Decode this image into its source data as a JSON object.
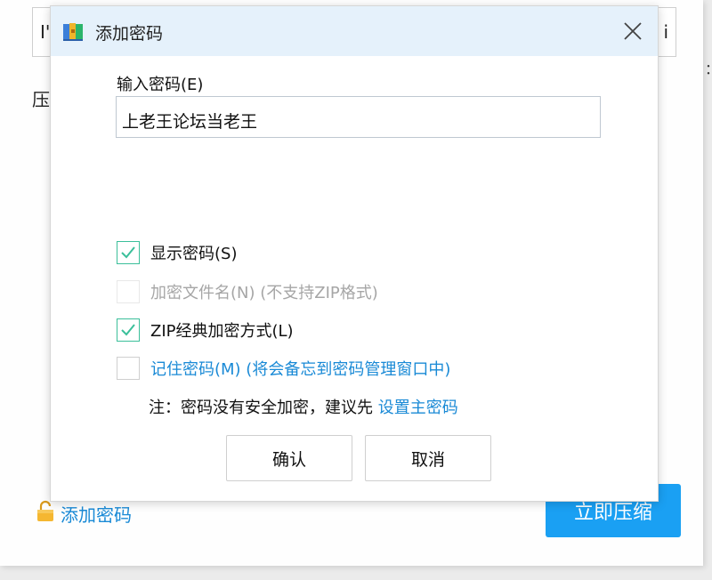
{
  "background": {
    "input_text_left": "I'",
    "input_text_right": "i",
    "compress_label": "压",
    "right_edge_mark": "：",
    "add_password_link": "添加密码",
    "compress_button": "立即压缩"
  },
  "dialog": {
    "title": "添加密码",
    "close_icon": "close-icon",
    "password_label": "输入密码(E)",
    "password_value": "上老王论坛当老王",
    "options": {
      "show_password": {
        "label": "显示密码(S)",
        "checked": true,
        "enabled": true
      },
      "encrypt_filenames": {
        "label": "加密文件名(N) (不支持ZIP格式)",
        "checked": false,
        "enabled": false
      },
      "zip_classic": {
        "label": "ZIP经典加密方式(L)",
        "checked": true,
        "enabled": true
      },
      "remember_password": {
        "label": "记住密码(M) (将会备忘到密码管理窗口中)",
        "checked": false,
        "enabled": true
      }
    },
    "note_prefix": "注：密码没有安全加密，建议先 ",
    "note_link": "设置主密码",
    "ok_button": "确认",
    "cancel_button": "取消"
  },
  "colors": {
    "titlebar": "#e5f1fb",
    "accent_link": "#1a8ad6",
    "checkbox_green": "#3bbf9a",
    "primary_button": "#1aa0f3"
  }
}
